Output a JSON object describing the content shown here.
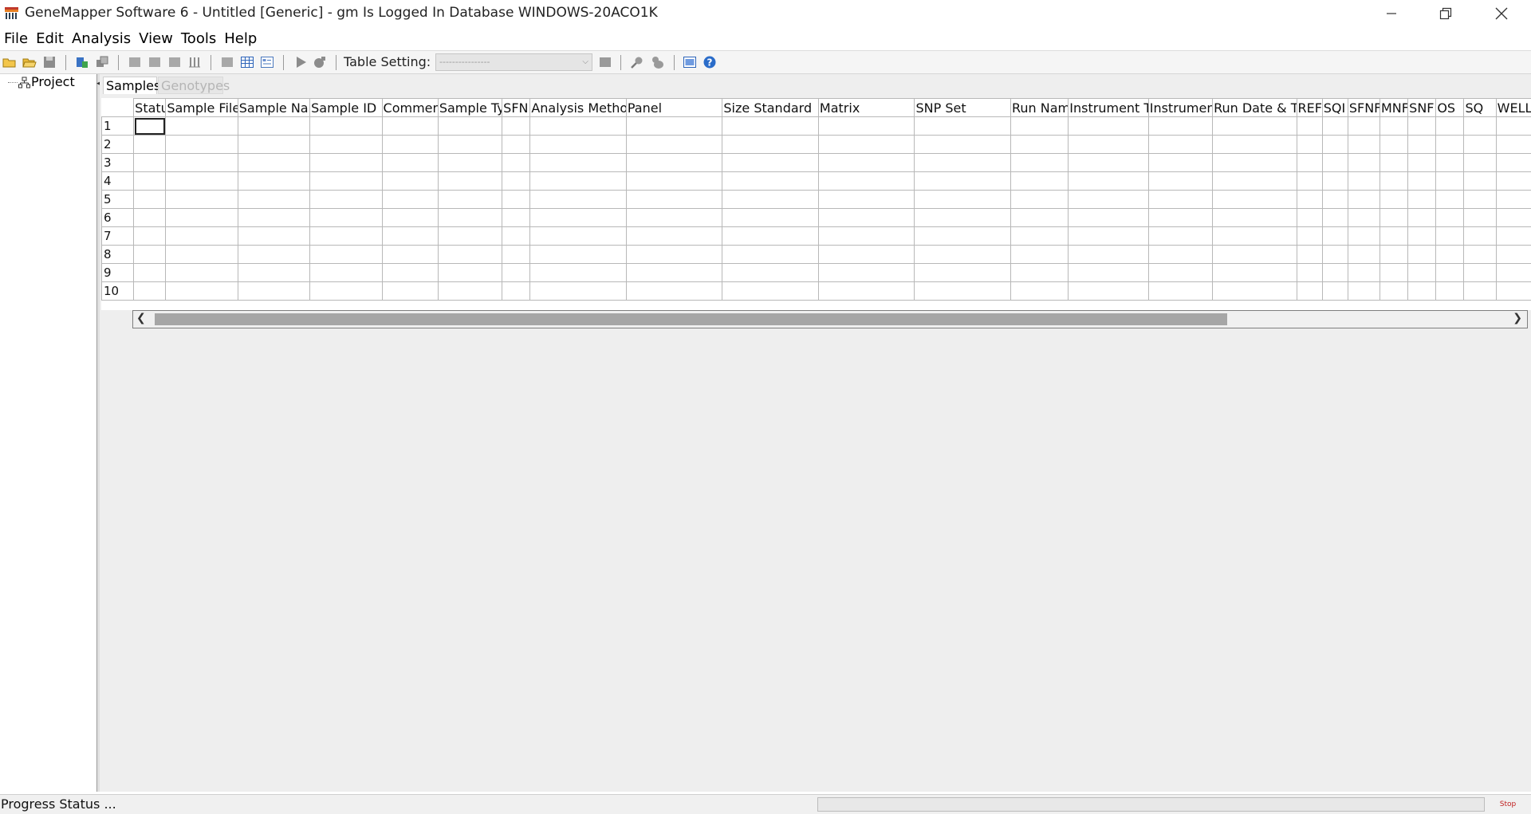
{
  "window": {
    "title": "GeneMapper Software 6 - Untitled [Generic] - gm Is Logged In Database WINDOWS-20ACO1K"
  },
  "menu": [
    "File",
    "Edit",
    "Analysis",
    "View",
    "Tools",
    "Help"
  ],
  "toolbar": {
    "table_setting_label": "Table Setting:",
    "table_setting_value": "----------------"
  },
  "tree": {
    "root_label": "Project"
  },
  "tabs": [
    {
      "label": "Samples",
      "active": true
    },
    {
      "label": "Genotypes",
      "active": false
    }
  ],
  "table": {
    "columns": [
      "Statu",
      "Sample File",
      "Sample Nan",
      "Sample ID",
      "Commen",
      "Sample Ty",
      "SFN",
      "Analysis Method",
      "Panel",
      "Size Standard",
      "Matrix",
      "SNP Set",
      "Run Nam",
      "Instrument T",
      "Instrumen",
      "Run Date & Ti",
      "REF",
      "SQI",
      "SFNF",
      "MNF",
      "SNF",
      "OS",
      "SQ",
      "WELL"
    ],
    "rows": [
      "1",
      "2",
      "3",
      "4",
      "5",
      "6",
      "7",
      "8",
      "9",
      "10"
    ]
  },
  "status": {
    "progress_label": "Progress Status ...",
    "stop_label": "Stop"
  },
  "colors": {
    "panel_bg": "#eeeeee",
    "grid_line": "#b8b8b8",
    "scroll_thumb": "#a6a6a6",
    "stop_text": "#c02020"
  }
}
